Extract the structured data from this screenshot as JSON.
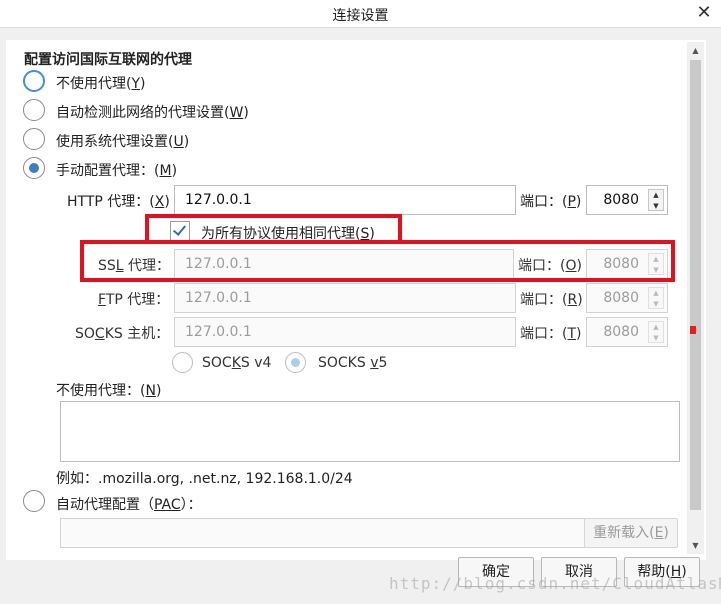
{
  "window": {
    "title": "连接设置",
    "close_glyph": "✕"
  },
  "section_title": "配置访问国际互联网的代理",
  "proxy_modes": [
    {
      "text": "不使用代理(",
      "key": "Y",
      "tail": ")"
    },
    {
      "text": "自动检测此网络的代理设置(",
      "key": "W",
      "tail": ")"
    },
    {
      "text": "使用系统代理设置(",
      "key": "U",
      "tail": ")"
    },
    {
      "text": "手动配置代理：(",
      "key": "M",
      "tail": ")"
    }
  ],
  "manual": {
    "http": {
      "label_pre": "HTTP 代理：(",
      "label_key": "X",
      "label_post": ")",
      "value": "127.0.0.1",
      "port_pre": "端口：(",
      "port_key": "P",
      "port_post": ")",
      "port": "8080"
    },
    "same_proxy": {
      "text_pre": "为所有协议使用相同代理(",
      "key": "S",
      "text_post": ")",
      "checked": true
    },
    "ssl": {
      "label_pre": "SS",
      "label_key": "L",
      "label_post": " 代理：",
      "value": "127.0.0.1",
      "port_pre": "端口：(",
      "port_key": "O",
      "port_post": ")",
      "port": "8080"
    },
    "ftp": {
      "label_key": "F",
      "label_post": "TP 代理：",
      "value": "127.0.0.1",
      "port_pre": "端口：(",
      "port_key": "R",
      "port_post": ")",
      "port": "8080"
    },
    "socks": {
      "label_pre": "SO",
      "label_key": "C",
      "label_post": "KS 主机：",
      "value": "127.0.0.1",
      "port_pre": "端口：(",
      "port_key": "T",
      "port_post": ")",
      "port": "8080"
    },
    "socks_v4": {
      "pre": "SOC",
      "key": "K",
      "post": "S v4"
    },
    "socks_v5": {
      "pre": "SOCKS ",
      "key": "v",
      "post": "5"
    }
  },
  "no_proxy": {
    "label_pre": "不使用代理：(",
    "key": "N",
    "label_post": ")",
    "value": "",
    "example": "例如：.mozilla.org, .net.nz, 192.168.1.0/24"
  },
  "pac": {
    "label_pre": "自动代理配置（",
    "key": "PAC",
    "label_post": "）：",
    "value": "",
    "reload_pre": "重新载入(",
    "reload_key": "E",
    "reload_post": ")"
  },
  "buttons": {
    "ok": "确定",
    "cancel": "取消",
    "help_pre": "帮助(",
    "help_key": "H",
    "help_post": ")"
  },
  "scroll_arrows": {
    "up": "▲",
    "down": "▼"
  },
  "spin_arrows": {
    "up": "▲",
    "down": "▼"
  },
  "watermark": "http://blog.csdn.net/CloudAtlasM",
  "colors": {
    "accent": "#3d7bc4",
    "annotation": "#e3101e"
  }
}
